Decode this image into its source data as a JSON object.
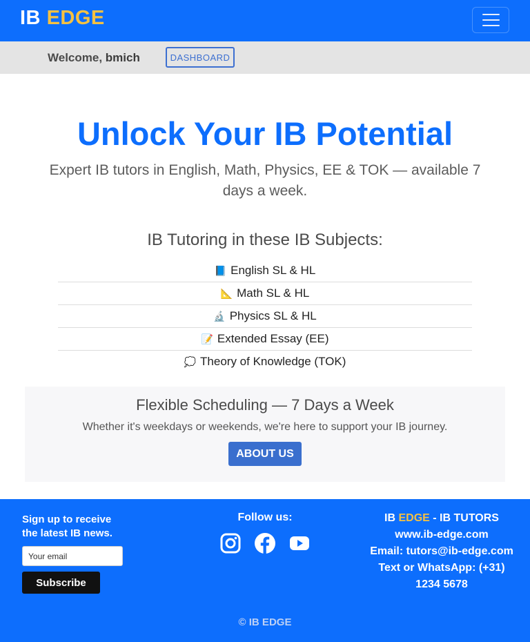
{
  "brand": {
    "prefix": "IB",
    "accent": "EDGE"
  },
  "welcome": {
    "label": "Welcome,",
    "username": "bmich",
    "dashboard_button": "DASHBOARD"
  },
  "hero": {
    "title": "Unlock Your IB Potential",
    "subtitle": "Expert IB tutors in English, Math, Physics, EE & TOK — available 7 days a week."
  },
  "subjects": {
    "heading": "IB Tutoring in these IB Subjects:",
    "items": [
      {
        "icon": "📘",
        "label": "English SL & HL"
      },
      {
        "icon": "📐",
        "label": "Math SL & HL"
      },
      {
        "icon": "🔬",
        "label": "Physics SL & HL"
      },
      {
        "icon": "📝",
        "label": "Extended Essay (EE)"
      },
      {
        "icon": "💭",
        "label": "Theory of Knowledge (TOK)"
      }
    ]
  },
  "schedule": {
    "title": "Flexible Scheduling — 7 Days a Week",
    "text": "Whether it's weekdays or weekends, we're here to support your IB journey.",
    "button": "ABOUT US"
  },
  "footer": {
    "signup_line1": "Sign up to receive",
    "signup_line2": "the latest IB news.",
    "email_placeholder": "Your email",
    "subscribe_button": "Subscribe",
    "follow_label": "Follow us:",
    "social": [
      "instagram-icon",
      "facebook-icon",
      "youtube-icon"
    ],
    "contact_prefix": "IB",
    "contact_accent": "EDGE",
    "contact_suffix": "- IB TUTORS",
    "website": "www.ib-edge.com",
    "email": "Email: tutors@ib-edge.com",
    "phone_line1": "Text or WhatsApp: (+31)",
    "phone_line2": "1234 5678",
    "copyright": "© IB EDGE"
  },
  "colors": {
    "primary": "#0d6efd",
    "accent": "#f5c142",
    "button": "#3a6fce"
  }
}
